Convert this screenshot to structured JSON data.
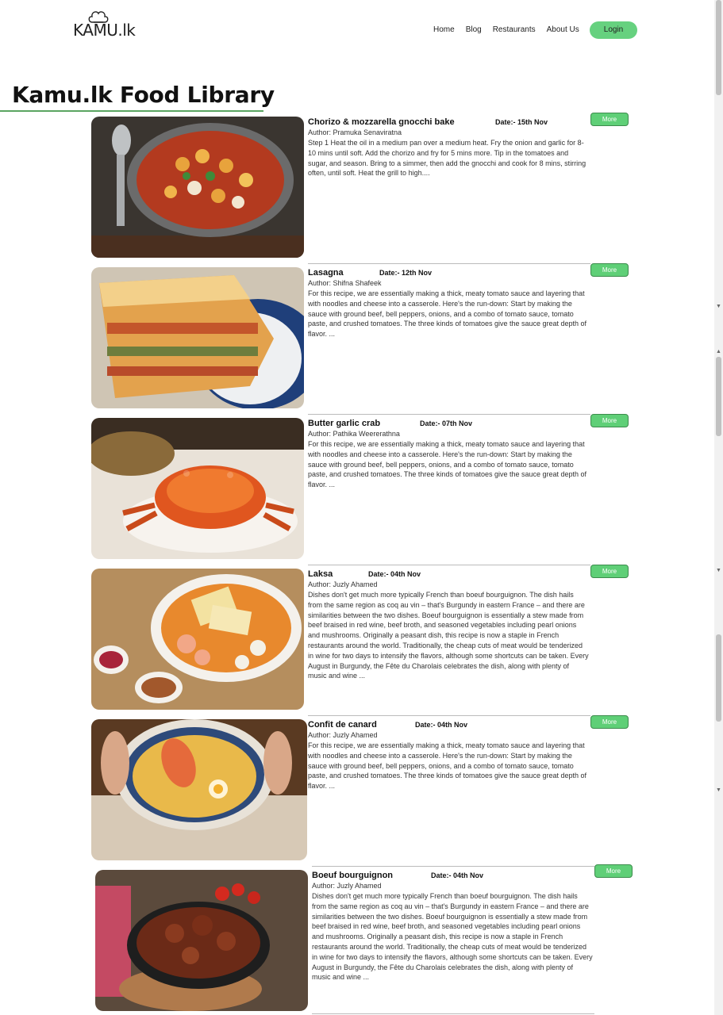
{
  "header": {
    "logo_text": "KAMU.lk",
    "nav": [
      "Home",
      "Blog",
      "Restaurants",
      "About Us"
    ],
    "login_label": "Login"
  },
  "page_title": "Kamu.lk Food Library",
  "more_label": "More",
  "recipes": [
    {
      "title": "Chorizo & mozzarella gnocchi bake",
      "date": "Date:- 15th Nov",
      "author": "Author: Pramuka Senaviratna",
      "desc": "Step 1 Heat the oil in a medium pan over a medium heat. Fry the onion and garlic for 8-10 mins until soft. Add the chorizo and fry for 5 mins more. Tip in the tomatoes and sugar, and season. Bring to a simmer, then add the gnocchi and cook for 8 mins, stirring often, until soft. Heat the grill to high...."
    },
    {
      "title": "Lasagna",
      "date": "Date:- 12th Nov",
      "author": "Author: Shifna Shafeek",
      "desc": "For this recipe, we are essentially making a thick, meaty tomato sauce and layering that with noodles and cheese into a casserole. Here's the run-down: Start by making the sauce with ground beef, bell peppers, onions, and a combo of tomato sauce, tomato paste, and crushed tomatoes. The three kinds of tomatoes give the sauce great depth of flavor. ..."
    },
    {
      "title": "Butter garlic crab",
      "date": "Date:- 07th Nov",
      "author": "Author: Pathika Weererathna",
      "desc": "For this recipe, we are essentially making a thick, meaty tomato sauce and layering that with noodles and cheese into a casserole. Here's the run-down: Start by making the sauce with ground beef, bell peppers, onions, and a combo of tomato sauce, tomato paste, and crushed tomatoes. The three kinds of tomatoes give the sauce great depth of flavor. ..."
    },
    {
      "title": "Laksa",
      "date": "Date:- 04th Nov",
      "author": "Author: Juzly Ahamed",
      "desc": "Dishes don't get much more typically French than boeuf bourguignon. The dish hails from the same region as coq au vin – that's Burgundy in eastern France – and there are similarities between the two dishes. Boeuf bourguignon is essentially a stew made from beef braised in red wine, beef broth, and seasoned vegetables including pearl onions and mushrooms. Originally a peasant dish, this recipe is now a staple in French restaurants around the world. Traditionally, the cheap cuts of meat would be tenderized in wine for two days to intensify the flavors, although some shortcuts can be taken. Every August in Burgundy, the Fête du Charolais celebrates the dish, along with plenty of music and wine ..."
    },
    {
      "title": "Confit de canard",
      "date": "Date:- 04th Nov",
      "author": "Author: Juzly Ahamed",
      "desc": "For this recipe, we are essentially making a thick, meaty tomato sauce and layering that with noodles and cheese into a casserole. Here's the run-down: Start by making the sauce with ground beef, bell peppers, onions, and a combo of tomato sauce, tomato paste, and crushed tomatoes. The three kinds of tomatoes give the sauce great depth of flavor. ..."
    },
    {
      "title": "Boeuf bourguignon",
      "date": "Date:- 04th Nov",
      "author": "Author: Juzly Ahamed",
      "desc": "Dishes don't get much more typically French than boeuf bourguignon. The dish hails from the same region as coq au vin – that's Burgundy in eastern France – and there are similarities between the two dishes. Boeuf bourguignon is essentially a stew made from beef braised in red wine, beef broth, and seasoned vegetables including pearl onions and mushrooms. Originally a peasant dish, this recipe is now a staple in French restaurants around the world. Traditionally, the cheap cuts of meat would be tenderized in wine for two days to intensify the flavors, although some shortcuts can be taken. Every August in Burgundy, the Fête du Charolais celebrates the dish, along with plenty of music and wine ..."
    }
  ]
}
